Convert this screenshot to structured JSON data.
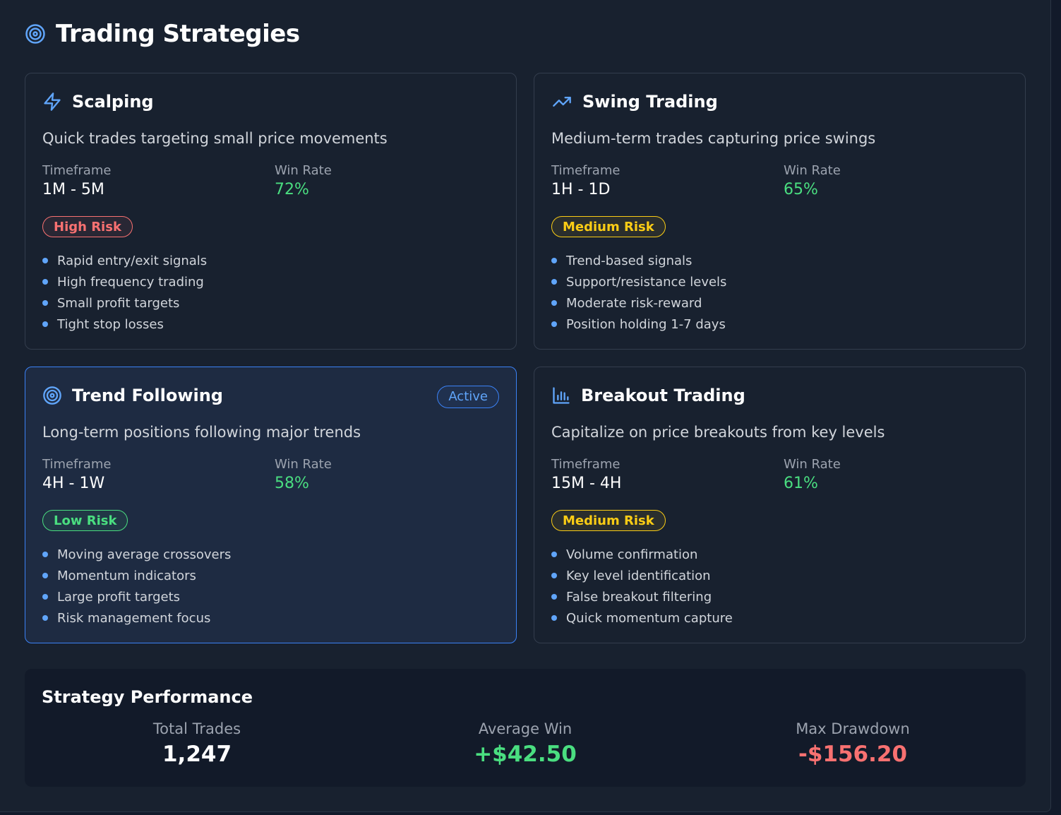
{
  "page": {
    "title": "Trading Strategies",
    "title_icon": "target-icon"
  },
  "strategies": [
    {
      "name": "Scalping",
      "icon": "lightning-icon",
      "description": "Quick trades targeting small price movements",
      "timeframe_label": "Timeframe",
      "timeframe": "1M - 5M",
      "winrate_label": "Win Rate",
      "winrate": "72%",
      "risk": "High Risk",
      "risk_level": "high",
      "features": [
        "Rapid entry/exit signals",
        "High frequency trading",
        "Small profit targets",
        "Tight stop losses"
      ]
    },
    {
      "name": "Swing Trading",
      "icon": "trending-up-icon",
      "description": "Medium-term trades capturing price swings",
      "timeframe_label": "Timeframe",
      "timeframe": "1H - 1D",
      "winrate_label": "Win Rate",
      "winrate": "65%",
      "risk": "Medium Risk",
      "risk_level": "medium",
      "features": [
        "Trend-based signals",
        "Support/resistance levels",
        "Moderate risk-reward",
        "Position holding 1-7 days"
      ]
    },
    {
      "name": "Trend Following",
      "icon": "target-icon",
      "active": true,
      "active_label": "Active",
      "description": "Long-term positions following major trends",
      "timeframe_label": "Timeframe",
      "timeframe": "4H - 1W",
      "winrate_label": "Win Rate",
      "winrate": "58%",
      "risk": "Low Risk",
      "risk_level": "low",
      "features": [
        "Moving average crossovers",
        "Momentum indicators",
        "Large profit targets",
        "Risk management focus"
      ]
    },
    {
      "name": "Breakout Trading",
      "icon": "bar-chart-icon",
      "description": "Capitalize on price breakouts from key levels",
      "timeframe_label": "Timeframe",
      "timeframe": "15M - 4H",
      "winrate_label": "Win Rate",
      "winrate": "61%",
      "risk": "Medium Risk",
      "risk_level": "medium",
      "features": [
        "Volume confirmation",
        "Key level identification",
        "False breakout filtering",
        "Quick momentum capture"
      ]
    }
  ],
  "performance": {
    "title": "Strategy Performance",
    "metrics": [
      {
        "label": "Total Trades",
        "value": "1,247",
        "color": "#ffffff"
      },
      {
        "label": "Average Win",
        "value": "+$42.50",
        "color": "#4ade80"
      },
      {
        "label": "Max Drawdown",
        "value": "-$156.20",
        "color": "#f87171"
      }
    ]
  },
  "colors": {
    "accent": "#60a5fa",
    "positive": "#4ade80",
    "negative": "#f87171",
    "warning": "#facc15",
    "background": "#18212f"
  }
}
